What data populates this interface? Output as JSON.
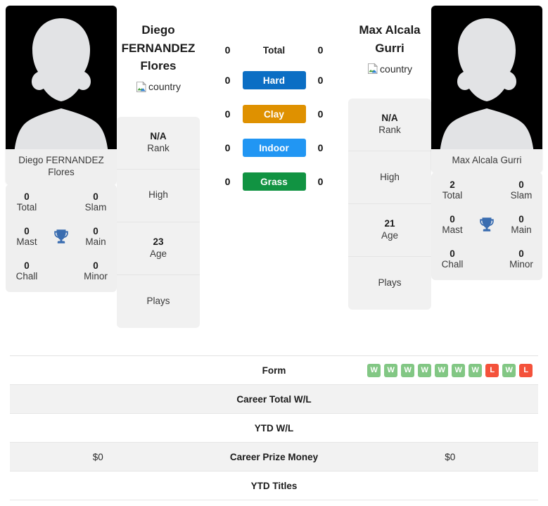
{
  "players": {
    "left": {
      "photo_caption": "Diego FERNANDEZ Flores",
      "name_lines": [
        "Diego",
        "FERNANDEZ",
        "Flores"
      ],
      "country_alt": "country",
      "trophies": {
        "total": "0",
        "total_label": "Total",
        "slam": "0",
        "slam_label": "Slam",
        "mast": "0",
        "mast_label": "Mast",
        "main": "0",
        "main_label": "Main",
        "chall": "0",
        "chall_label": "Chall",
        "minor": "0",
        "minor_label": "Minor"
      },
      "info": [
        {
          "value": "N/A",
          "label": "Rank"
        },
        {
          "value": "",
          "label": "High"
        },
        {
          "value": "23",
          "label": "Age"
        },
        {
          "value": "",
          "label": "Plays"
        }
      ]
    },
    "right": {
      "photo_caption": "Max Alcala Gurri",
      "name_lines": [
        "Max Alcala",
        "Gurri"
      ],
      "country_alt": "country",
      "trophies": {
        "total": "2",
        "total_label": "Total",
        "slam": "0",
        "slam_label": "Slam",
        "mast": "0",
        "mast_label": "Mast",
        "main": "0",
        "main_label": "Main",
        "chall": "0",
        "chall_label": "Chall",
        "minor": "0",
        "minor_label": "Minor"
      },
      "info": [
        {
          "value": "N/A",
          "label": "Rank"
        },
        {
          "value": "",
          "label": "High"
        },
        {
          "value": "21",
          "label": "Age"
        },
        {
          "value": "",
          "label": "Plays"
        }
      ]
    }
  },
  "head_to_head": [
    {
      "key": "total",
      "label": "Total",
      "left": "0",
      "right": "0",
      "badge": false,
      "color": ""
    },
    {
      "key": "hard",
      "label": "Hard",
      "left": "0",
      "right": "0",
      "badge": true,
      "color": "#0b6ec4"
    },
    {
      "key": "clay",
      "label": "Clay",
      "left": "0",
      "right": "0",
      "badge": true,
      "color": "#df9100"
    },
    {
      "key": "indoor",
      "label": "Indoor",
      "left": "0",
      "right": "0",
      "badge": true,
      "color": "#2196f3"
    },
    {
      "key": "grass",
      "label": "Grass",
      "left": "0",
      "right": "0",
      "badge": true,
      "color": "#119342"
    }
  ],
  "stats_rows": [
    {
      "key": "form",
      "label": "Form",
      "left_value": "",
      "right_value": "",
      "left_form": [],
      "right_form": [
        "W",
        "W",
        "W",
        "W",
        "W",
        "W",
        "W",
        "L",
        "W",
        "L"
      ]
    },
    {
      "key": "career-total-wl",
      "label": "Career Total W/L",
      "left_value": "",
      "right_value": "",
      "left_form": [],
      "right_form": []
    },
    {
      "key": "ytd-wl",
      "label": "YTD W/L",
      "left_value": "",
      "right_value": "",
      "left_form": [],
      "right_form": []
    },
    {
      "key": "career-prize-money",
      "label": "Career Prize Money",
      "left_value": "$0",
      "right_value": "$0",
      "left_form": [],
      "right_form": []
    },
    {
      "key": "ytd-titles",
      "label": "YTD Titles",
      "left_value": "",
      "right_value": "",
      "left_form": [],
      "right_form": []
    }
  ],
  "colors": {
    "hard": "#0b6ec4",
    "clay": "#df9100",
    "indoor": "#2196f3",
    "grass": "#119342",
    "win": "#82c784",
    "loss": "#f4523b",
    "trophy": "#3a6db0"
  }
}
